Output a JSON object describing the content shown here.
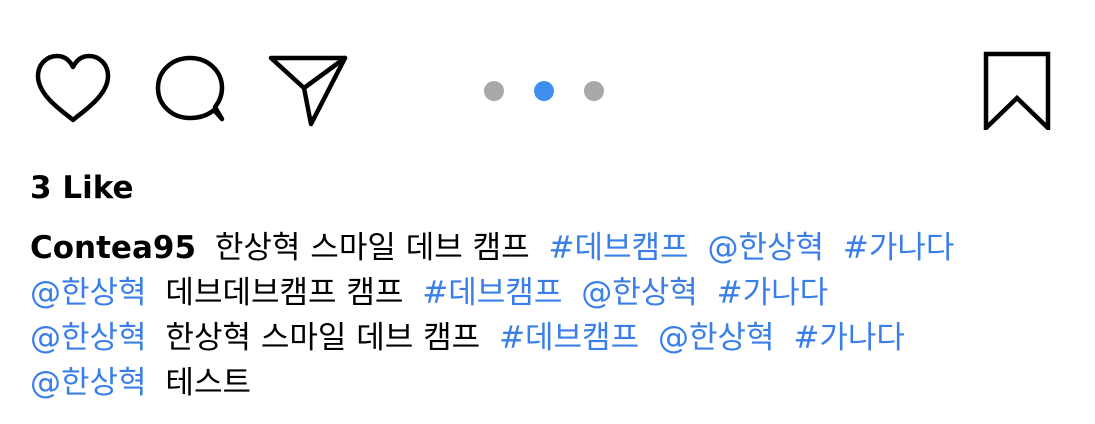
{
  "post": {
    "actions": {
      "like_icon": "heart-icon",
      "comment_icon": "comment-bubble-icon",
      "share_icon": "paper-plane-icon",
      "bookmark_icon": "bookmark-icon"
    },
    "carousel": {
      "count": 3,
      "active_index": 1,
      "active_color": "#3f8ff0",
      "inactive_color": "#a8a8a8"
    },
    "likes_text": "3 Like",
    "caption": {
      "username": "Contea95",
      "lines": [
        [
          {
            "text": "한상혁 스마일 데브 캠프",
            "kind": "text"
          },
          {
            "text": "#데브캠프",
            "kind": "hashtag"
          },
          {
            "text": "@한상혁",
            "kind": "mention"
          },
          {
            "text": "#가나다",
            "kind": "hashtag"
          }
        ],
        [
          {
            "text": "@한상혁",
            "kind": "mention"
          },
          {
            "text": "데브데브캠프 캠프",
            "kind": "text"
          },
          {
            "text": "#데브캠프",
            "kind": "hashtag"
          },
          {
            "text": "@한상혁",
            "kind": "mention"
          },
          {
            "text": "#가나다",
            "kind": "hashtag"
          }
        ],
        [
          {
            "text": "@한상혁",
            "kind": "mention"
          },
          {
            "text": "한상혁 스마일 데브 캠프",
            "kind": "text"
          },
          {
            "text": "#데브캠프",
            "kind": "hashtag"
          },
          {
            "text": "@한상혁",
            "kind": "mention"
          },
          {
            "text": "#가나다",
            "kind": "hashtag"
          }
        ],
        [
          {
            "text": "@한상혁",
            "kind": "mention"
          },
          {
            "text": "테스트",
            "kind": "text"
          }
        ]
      ]
    },
    "colors": {
      "link": "#3a7fe8"
    }
  }
}
